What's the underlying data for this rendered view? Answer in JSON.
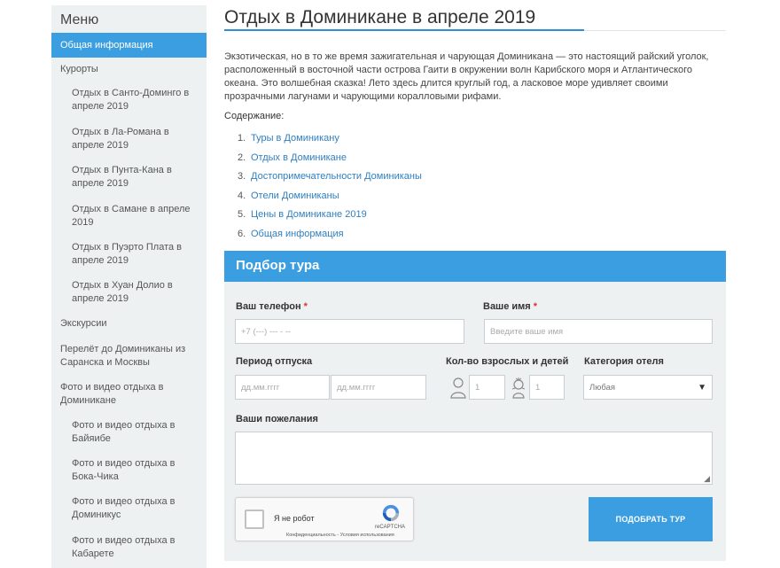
{
  "sidebar": {
    "title": "Меню",
    "items": [
      {
        "label": "Общая информация",
        "level": 0,
        "active": true
      },
      {
        "label": "Курорты",
        "level": 1
      },
      {
        "label": "Отдых в Санто-Доминго в апреле 2019",
        "level": 2
      },
      {
        "label": "Отдых в Ла-Романа в апреле 2019",
        "level": 2
      },
      {
        "label": "Отдых в Пунта-Кана в апреле 2019",
        "level": 2
      },
      {
        "label": "Отдых в Самане в апреле 2019",
        "level": 2
      },
      {
        "label": "Отдых в Пуэрто Плата в апреле 2019",
        "level": 2
      },
      {
        "label": "Отдых в Хуан Долио в апреле 2019",
        "level": 2
      },
      {
        "label": "Экскурсии",
        "level": 1
      },
      {
        "label": "Перелёт до Доминиканы из Саранска и Москвы",
        "level": 1
      },
      {
        "label": "Фото и видео отдыха в Доминикане",
        "level": 1
      },
      {
        "label": "Фото и видео отдыха в Байяибе",
        "level": 2
      },
      {
        "label": "Фото и видео отдыха в Бока-Чика",
        "level": 2
      },
      {
        "label": "Фото и видео отдыха в Доминикус",
        "level": 2
      },
      {
        "label": "Фото и видео отдыха в Кабарете",
        "level": 2
      }
    ]
  },
  "main": {
    "title": "Отдых в Доминикане в апреле 2019",
    "intro": "Экзотическая, но в то же время зажигательная и чарующая Доминикана — это настоящий райский уголок, расположенный в восточной части острова Гаити в окружении волн Карибского моря и Атлантического океана. Это волшебная сказка! Лето здесь длится круглый год, а ласковое море удивляет своими прозрачными лагунами и чарующими коралловыми рифами.",
    "toc_label": "Содержание:",
    "toc": [
      {
        "num": "1.",
        "label": "Туры в Доминикану"
      },
      {
        "num": "2.",
        "label": "Отдых в Доминикане"
      },
      {
        "num": "3.",
        "label": "Достопримечательности Доминиканы"
      },
      {
        "num": "4.",
        "label": "Отели Доминиканы"
      },
      {
        "num": "5.",
        "label": "Цены в Доминикане 2019"
      },
      {
        "num": "6.",
        "label": "Общая информация"
      }
    ]
  },
  "form": {
    "title": "Подбор тура",
    "phone_label": "Ваш телефон",
    "phone_placeholder": "+7 (---) --- - --",
    "name_label": "Ваше имя",
    "name_placeholder": "Введите ваше имя",
    "required_mark": "*",
    "period_label": "Период отпуска",
    "date_from_placeholder": "дд.мм.гггг",
    "date_to_placeholder": "дд.мм.гггг",
    "guests_label": "Кол-во взрослых и детей",
    "adults_value": "1",
    "children_value": "1",
    "category_label": "Категория отеля",
    "category_value": "Любая",
    "wishes_label": "Ваши пожелания",
    "captcha_label": "Я не робот",
    "captcha_brand": "reCAPTCHA",
    "captcha_terms": "Конфиденциальность - Условия использования",
    "submit_label": "ПОДОБРАТЬ ТУР"
  },
  "colors": {
    "accent": "#3a9ee0",
    "link": "#2f7fc1",
    "sidebar_bg": "#eef1f2"
  }
}
